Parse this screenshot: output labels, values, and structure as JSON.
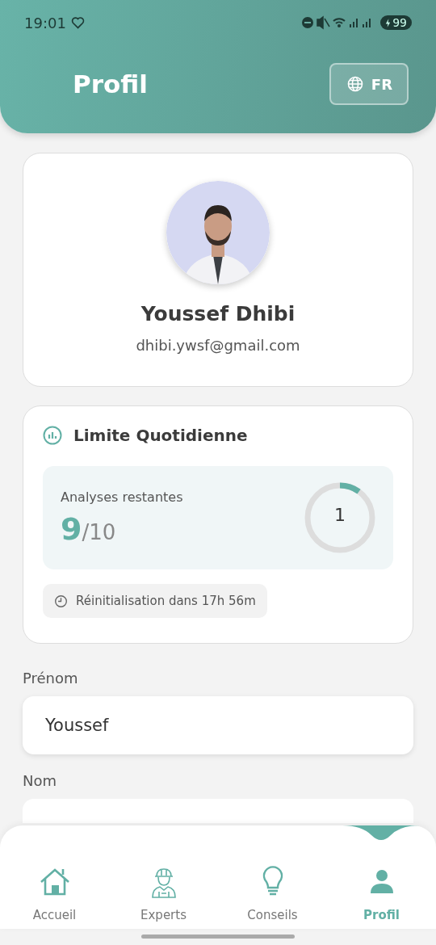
{
  "status_bar": {
    "time": "19:01",
    "battery": "99"
  },
  "header": {
    "title": "Profil",
    "language_button": "FR"
  },
  "profile": {
    "name": "Youssef Dhibi",
    "email": "dhibi.ywsf@gmail.com"
  },
  "daily_limit": {
    "title": "Limite Quotidienne",
    "label": "Analyses restantes",
    "remaining": "9",
    "total": "/10",
    "used": "1",
    "reset": "Réinitialisation dans 17h 56m"
  },
  "fields": [
    {
      "label": "Prénom",
      "value": "Youssef"
    },
    {
      "label": "Nom"
    }
  ],
  "nav": [
    {
      "label": "Accueil",
      "selected": false
    },
    {
      "label": "Experts",
      "selected": false
    },
    {
      "label": "Conseils",
      "selected": false
    },
    {
      "label": "Profil",
      "selected": true
    }
  ]
}
